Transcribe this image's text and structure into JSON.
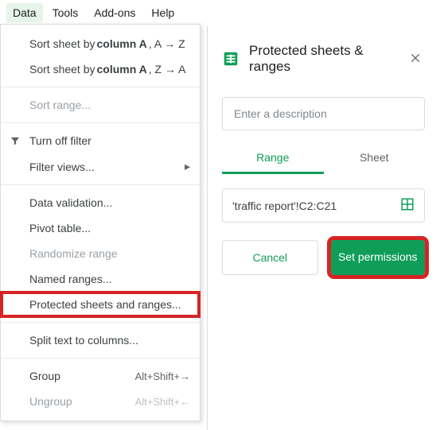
{
  "menubar": {
    "data": "Data",
    "tools": "Tools",
    "addons": "Add-ons",
    "help": "Help"
  },
  "menu": {
    "sort_az_prefix": "Sort sheet by ",
    "sort_col": "column A",
    "sort_az_suffix": ", A → Z",
    "sort_za_prefix": "Sort sheet by ",
    "sort_za_suffix": ", Z → A",
    "sort_range": "Sort range...",
    "turn_off_filter": "Turn off filter",
    "filter_views": "Filter views...",
    "data_validation": "Data validation...",
    "pivot_table": "Pivot table...",
    "randomize": "Randomize range",
    "named_ranges": "Named ranges...",
    "protected": "Protected sheets and ranges...",
    "split_text": "Split text to columns...",
    "group": "Group",
    "group_shortcut": "Alt+Shift+→",
    "ungroup": "Ungroup",
    "ungroup_shortcut": "Alt+Shift+←"
  },
  "panel": {
    "title": "Protected sheets & ranges",
    "desc_placeholder": "Enter a description",
    "tab_range": "Range",
    "tab_sheet": "Sheet",
    "range_value": "'traffic report'!C2:C21",
    "cancel": "Cancel",
    "set_permissions": "Set permissions"
  }
}
